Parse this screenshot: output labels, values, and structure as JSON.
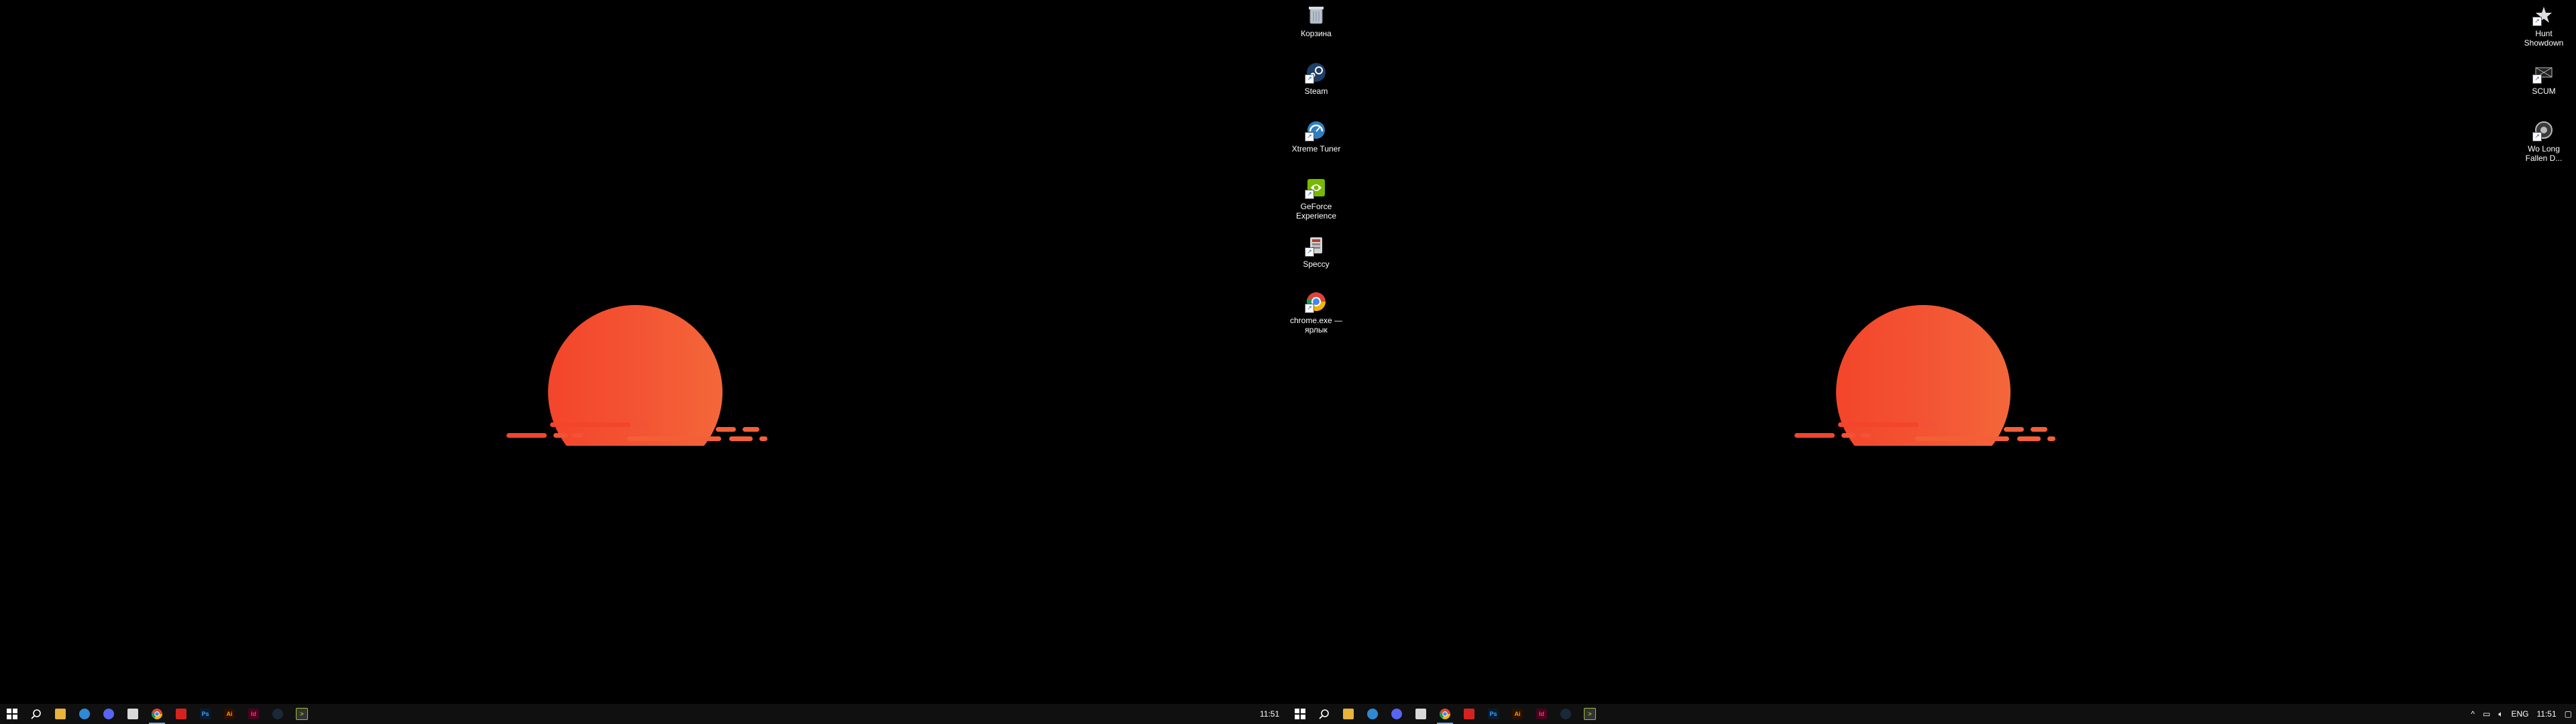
{
  "desktop_center": [
    {
      "label": "Корзина",
      "icon": "recycle-bin-icon"
    },
    {
      "label": "Steam",
      "icon": "steam-icon"
    },
    {
      "label": "Xtreme Tuner",
      "icon": "xtreme-tuner-icon"
    },
    {
      "label": "GeForce Experience",
      "icon": "geforce-experience-icon"
    },
    {
      "label": "Speccy",
      "icon": "speccy-icon"
    },
    {
      "label": "chrome.exe — ярлык",
      "icon": "chrome-icon"
    }
  ],
  "desktop_right": [
    {
      "label": "Hunt Showdown",
      "icon": "hunt-showdown-icon"
    },
    {
      "label": "SCUM",
      "icon": "scum-icon"
    },
    {
      "label": "Wo Long Fallen D...",
      "icon": "wo-long-icon"
    }
  ],
  "taskbar_left": {
    "apps": [
      {
        "name": "start-icon"
      },
      {
        "name": "search-icon"
      },
      {
        "name": "file-explorer-icon"
      },
      {
        "name": "edge-icon"
      },
      {
        "name": "discord-icon"
      },
      {
        "name": "notepad-icon"
      },
      {
        "name": "chrome-icon",
        "active": true
      },
      {
        "name": "acrobat-icon"
      },
      {
        "name": "photoshop-icon"
      },
      {
        "name": "illustrator-icon"
      },
      {
        "name": "indesign-icon"
      },
      {
        "name": "steam-icon"
      },
      {
        "name": "terminal-icon"
      }
    ]
  },
  "taskbar_right": {
    "clock_left": "11:51",
    "tray": {
      "lang": "ENG",
      "time": "11:51"
    }
  }
}
